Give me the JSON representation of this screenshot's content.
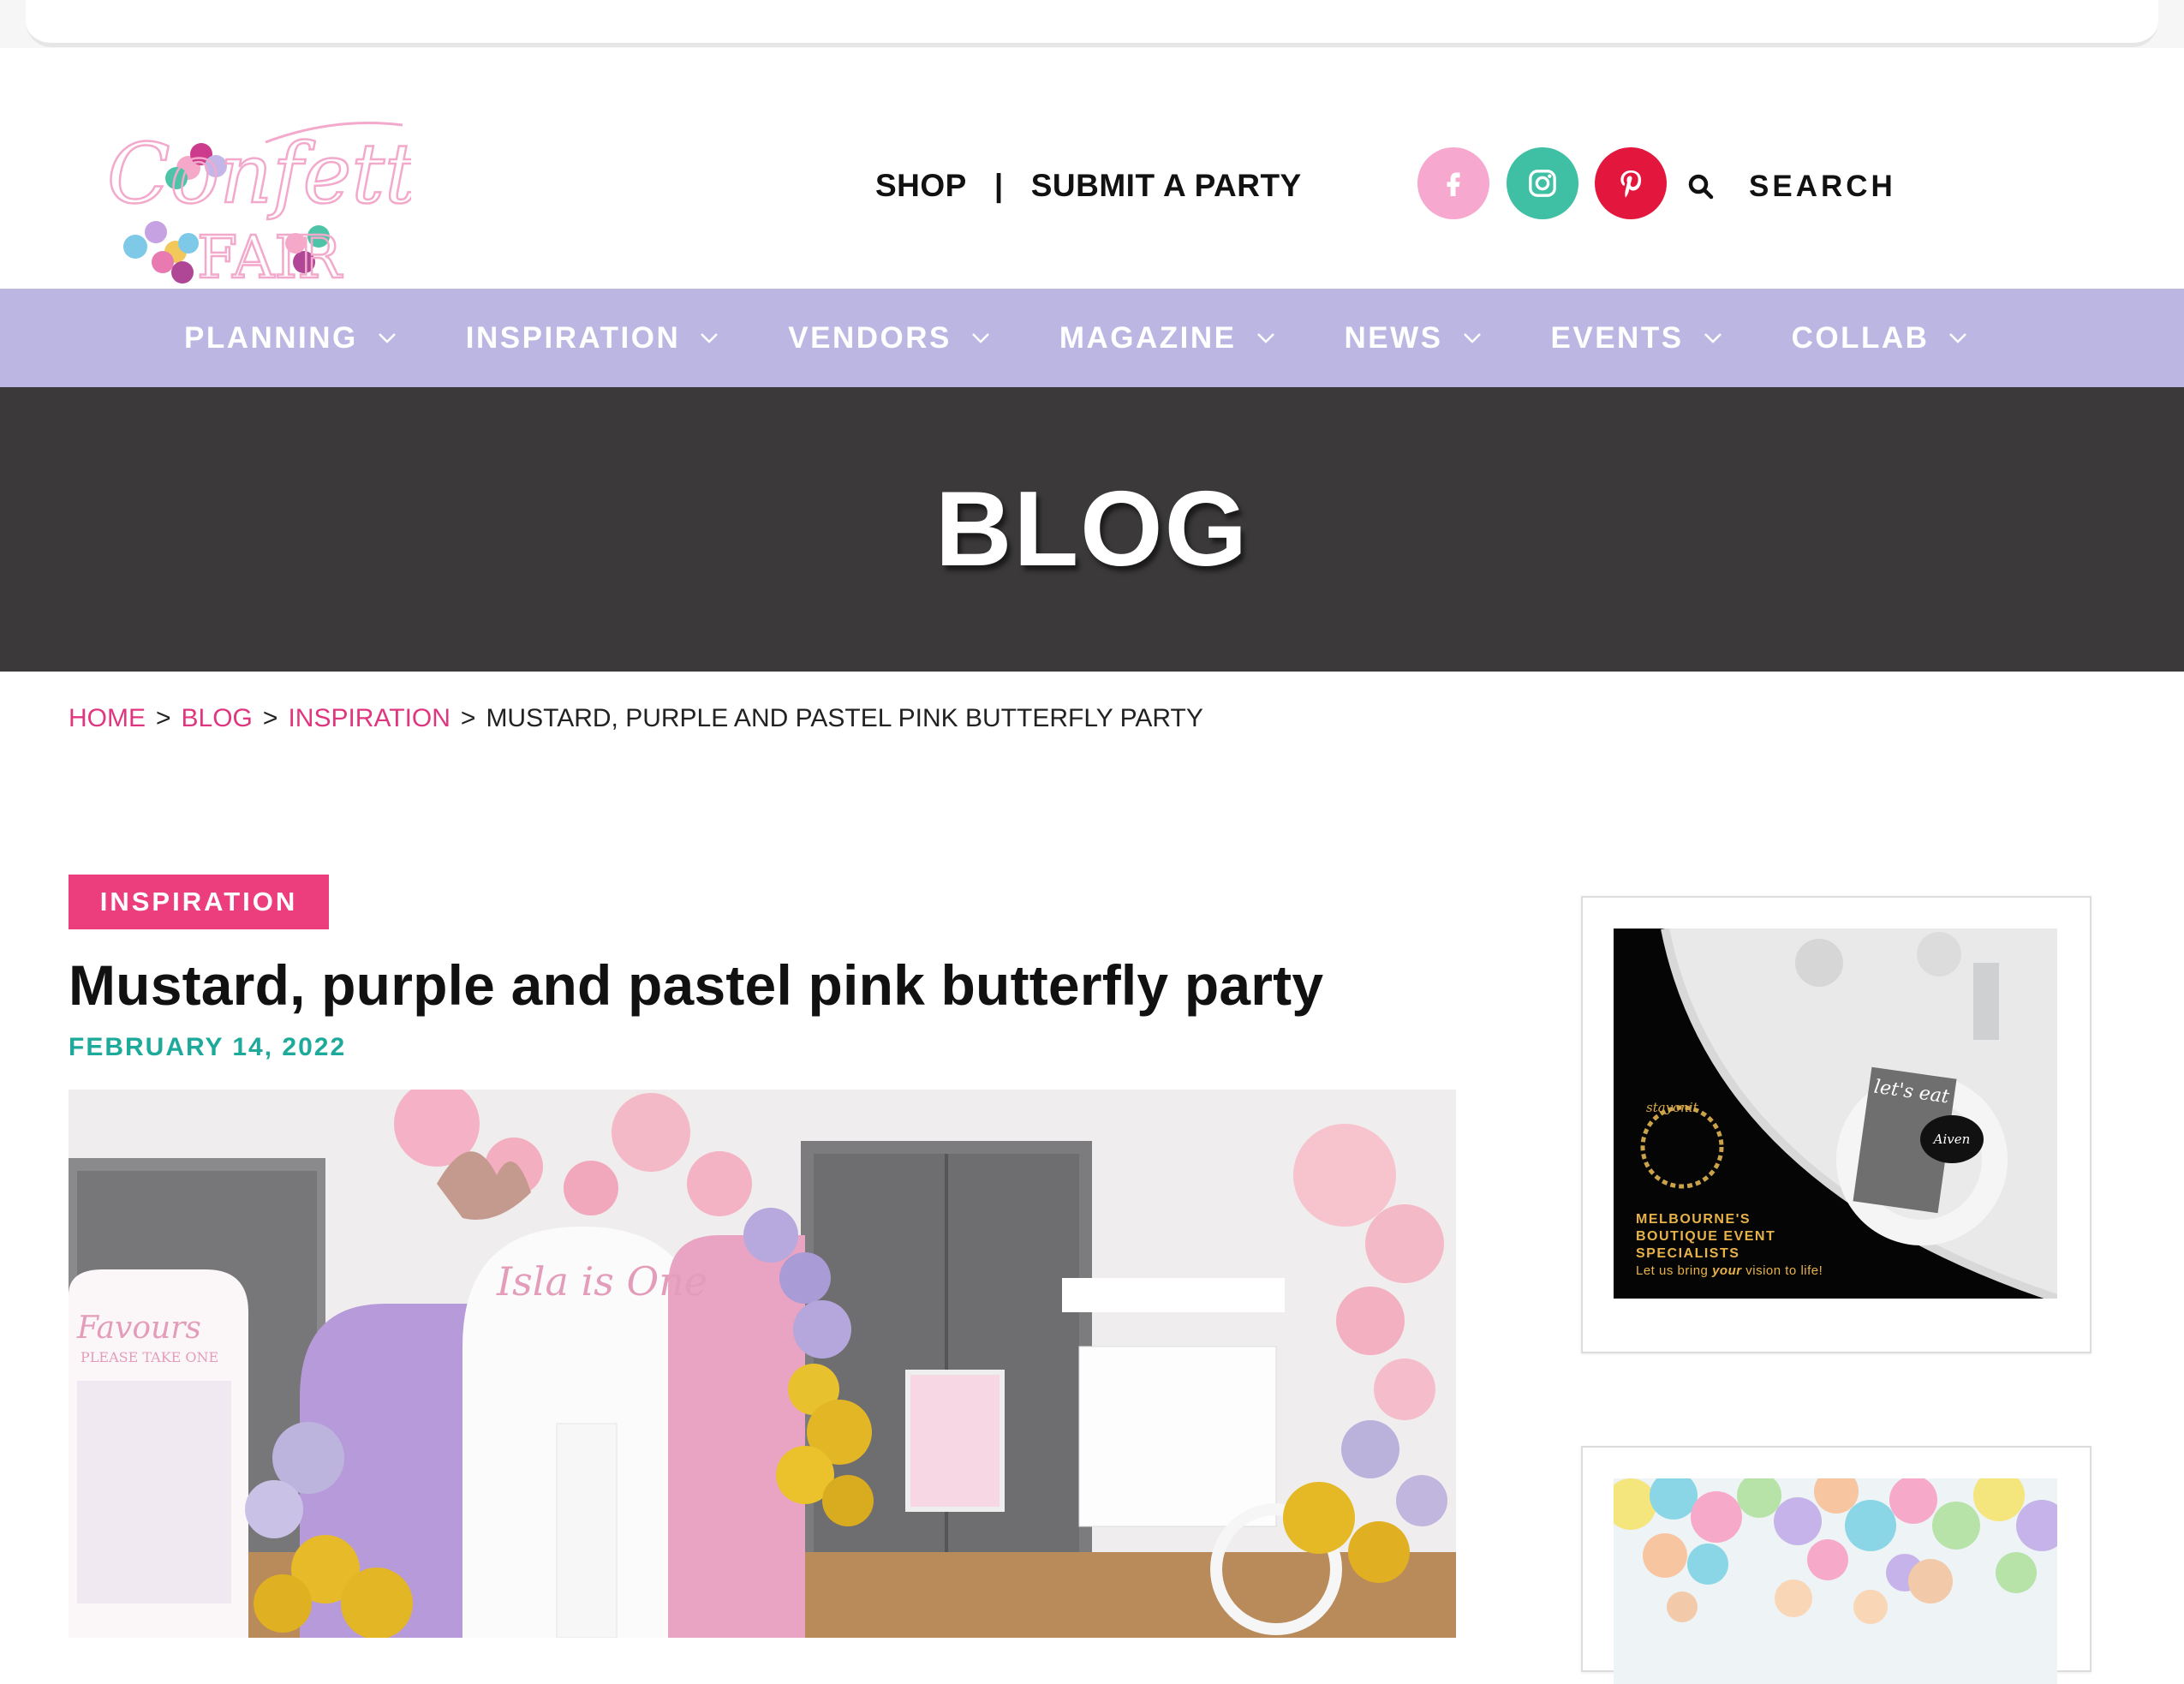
{
  "header": {
    "logo_text": "Confetti FAIR",
    "links": [
      "SHOP",
      "|",
      "SUBMIT A PARTY"
    ],
    "social": [
      "facebook-icon",
      "instagram-icon",
      "pinterest-icon"
    ],
    "search_label": "SEARCH"
  },
  "nav": {
    "items": [
      "PLANNING",
      "INSPIRATION",
      "VENDORS",
      "MAGAZINE",
      "NEWS",
      "EVENTS",
      "COLLAB"
    ]
  },
  "banner": {
    "title": "BLOG"
  },
  "breadcrumb": {
    "home": "HOME",
    "blog": "BLOG",
    "category": "INSPIRATION",
    "current": "MUSTARD, PURPLE AND PASTEL PINK BUTTERFLY PARTY",
    "separator": ">"
  },
  "post": {
    "category": "INSPIRATION",
    "title": "Mustard, purple and pastel pink butterfly party",
    "date": "FEBRUARY 14, 2022",
    "hero_text_1": "Isla is One",
    "hero_text_2": "Favours",
    "hero_text_3": "PLEASE TAKE ONE"
  },
  "sidebar": {
    "ad1": {
      "brand": "stayonit",
      "line1": "MELBOURNE'S",
      "line2": "BOUTIQUE EVENT",
      "line3": "SPECIALISTS",
      "tagline_before": "Let us bring",
      "tagline_em": "your",
      "tagline_after": "vision to life!",
      "card_text": "let's eat",
      "name_tag": "Aiven"
    }
  },
  "colors": {
    "nav_bg": "#bbb7e2",
    "banner_bg": "#3b393a",
    "accent_pink": "#ec3e7d",
    "accent_teal": "#1eaa9b",
    "facebook": "#f7a8cf",
    "instagram": "#3fbfa3",
    "pinterest": "#e3173e"
  }
}
